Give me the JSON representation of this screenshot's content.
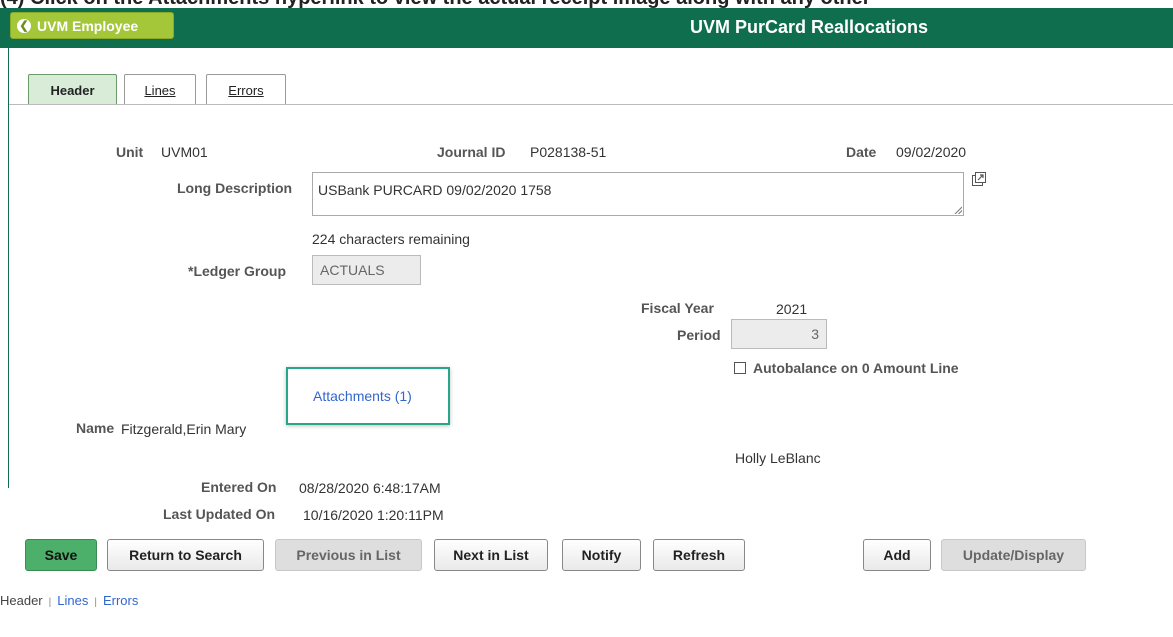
{
  "top_clip_text": "(4) Click on the Attachments hyperlink to view the actual receipt image along with any other",
  "topbar": {
    "back_label": "UVM Employee",
    "title": "UVM PurCard Reallocations"
  },
  "tabs": [
    {
      "label": "Header",
      "active": true
    },
    {
      "label": "Lines",
      "active": false
    },
    {
      "label": "Errors",
      "active": false
    }
  ],
  "header": {
    "unit_label": "Unit",
    "unit_value": "UVM01",
    "journal_label": "Journal ID",
    "journal_value": "P028138-51",
    "date_label": "Date",
    "date_value": "09/02/2020",
    "long_desc_label": "Long Description",
    "long_desc_value": "USBank PURCARD 09/02/2020 1758",
    "chars_remaining": "224 characters remaining",
    "ledger_label": "*Ledger Group",
    "ledger_value": "ACTUALS",
    "fiscal_year_label": "Fiscal Year",
    "fiscal_year_value": "2021",
    "period_label": "Period",
    "period_value": "3",
    "autobalance_label": "Autobalance on 0 Amount Line",
    "attachments_label": "Attachments (1)",
    "name_label": "Name",
    "name_value": "Fitzgerald,Erin Mary",
    "approver_value": "Holly LeBlanc",
    "entered_label": "Entered On",
    "entered_value": "08/28/2020  6:48:17AM",
    "updated_label": "Last Updated On",
    "updated_value": "10/16/2020  1:20:11PM"
  },
  "buttons": {
    "save": "Save",
    "return_to_search": "Return to Search",
    "previous_in_list": "Previous in List",
    "next_in_list": "Next in List",
    "notify": "Notify",
    "refresh": "Refresh",
    "add": "Add",
    "update_display": "Update/Display"
  },
  "bottom_links": {
    "header": "Header",
    "lines": "Lines",
    "errors": "Errors"
  },
  "colors": {
    "topbar": "#0e6e4d",
    "back_button": "#a4c639",
    "save_button": "#4db06a",
    "highlight_box": "#29a58a",
    "link": "#3366cc"
  },
  "icons": {
    "back": "chevron-left-circle-icon",
    "popup": "expand-window-icon",
    "resize": "resize-grip-icon"
  }
}
